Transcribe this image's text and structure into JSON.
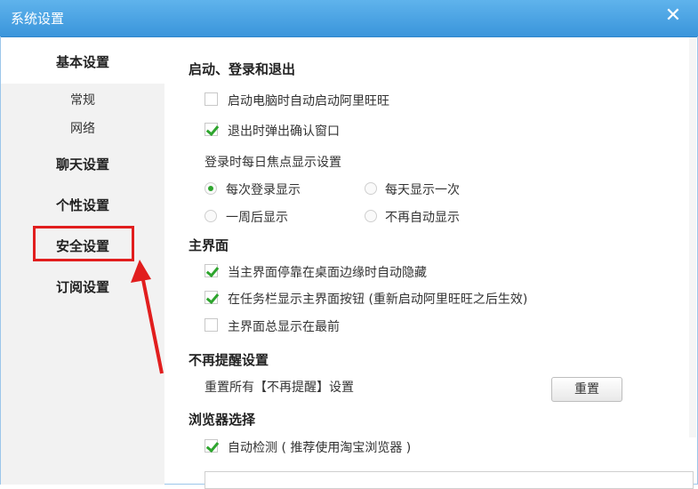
{
  "window": {
    "title": "系统设置"
  },
  "sidebar": {
    "items": [
      {
        "label": "基本设置"
      },
      {
        "label": "常规"
      },
      {
        "label": "网络"
      },
      {
        "label": "聊天设置"
      },
      {
        "label": "个性设置"
      },
      {
        "label": "安全设置"
      },
      {
        "label": "订阅设置"
      }
    ]
  },
  "content": {
    "startup": {
      "title": "启动、登录和退出",
      "auto_start": {
        "label": "启动电脑时自动启动阿里旺旺",
        "checked": false
      },
      "confirm_exit": {
        "label": "退出时弹出确认窗口",
        "checked": true
      },
      "daily_focus_label": "登录时每日焦点显示设置",
      "options": [
        {
          "label": "每次登录显示",
          "checked": true
        },
        {
          "label": "每天显示一次",
          "checked": false
        },
        {
          "label": "一周后显示",
          "checked": false
        },
        {
          "label": "不再自动显示",
          "checked": false
        }
      ]
    },
    "main_ui": {
      "title": "主界面",
      "auto_hide": {
        "label": "当主界面停靠在桌面边缘时自动隐藏",
        "checked": true
      },
      "taskbar_button": {
        "label": "在任务栏显示主界面按钮 (重新启动阿里旺旺之后生效)",
        "checked": true
      },
      "always_on_top": {
        "label": "主界面总显示在最前",
        "checked": false
      }
    },
    "no_remind": {
      "title": "不再提醒设置",
      "reset_label": "重置所有【不再提醒】设置",
      "reset_button": "重置"
    },
    "browser": {
      "title": "浏览器选择",
      "auto_detect": {
        "label": "自动检测 ( 推荐使用淘宝浏览器 )",
        "checked": true
      }
    }
  },
  "colors": {
    "titlebar": "#3a95db",
    "check": "#2ea52e",
    "highlight": "#e11e1e"
  }
}
